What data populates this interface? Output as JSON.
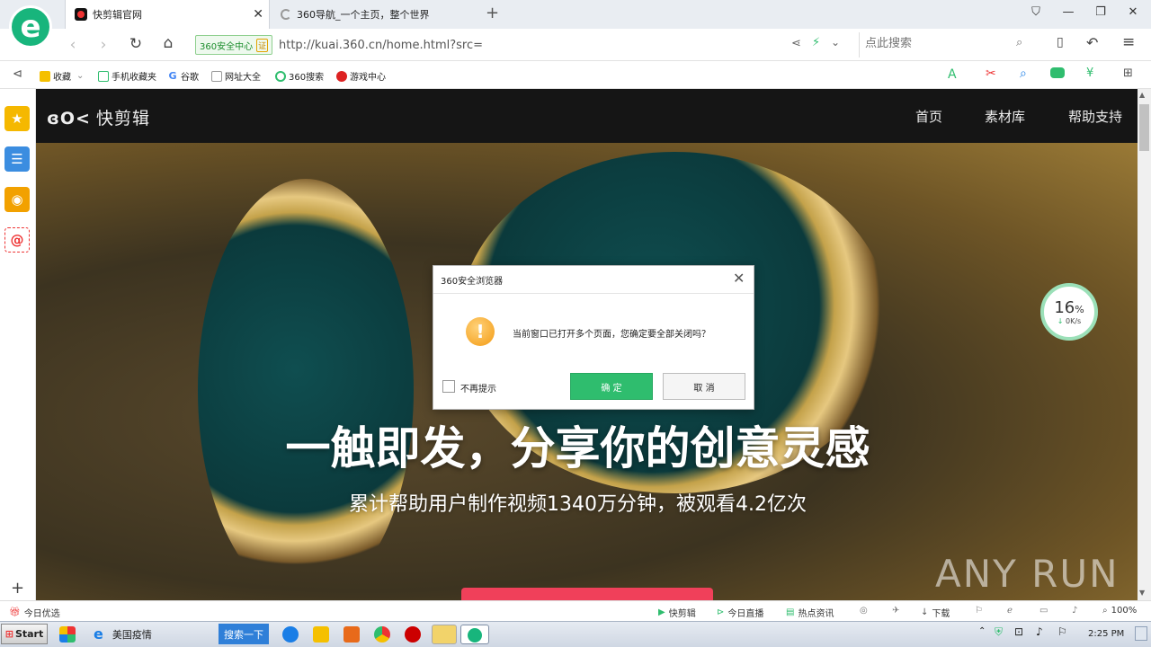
{
  "browser": {
    "tabs": [
      {
        "title": "快剪辑官网",
        "active": true
      },
      {
        "title": "360导航_一个主页，整个世界",
        "active": false
      }
    ],
    "address": {
      "security_badge": "360安全中心",
      "security_badge_cert": "证",
      "url": "http://kuai.360.cn/home.html?src=",
      "search_placeholder": "点此搜索"
    },
    "bookmarks": [
      "收藏",
      "手机收藏夹",
      "谷歌",
      "网址大全",
      "360搜索",
      "游戏中心"
    ]
  },
  "site": {
    "logo": "快剪辑",
    "nav": [
      "首页",
      "素材库",
      "帮助支持"
    ],
    "hero_title": "一触即发，分享你的创意灵感",
    "hero_subtitle": "累计帮助用户制作视频1340万分钟，被观看4.2亿次",
    "speed_widget": {
      "percent": "16",
      "percent_unit": "%",
      "rate": "0K/s"
    }
  },
  "dialog": {
    "title": "360安全浏览器",
    "message": "当前窗口已打开多个页面，您确定要全部关闭吗？",
    "checkbox_label": "不再提示",
    "ok_label": "确 定",
    "cancel_label": "取 消"
  },
  "statusbar": {
    "left": "今日优选",
    "items": [
      "快剪辑",
      "今日直播",
      "热点资讯",
      "下载"
    ],
    "zoom": "100%"
  },
  "taskbar": {
    "start": "Start",
    "items": [
      "美国疫情",
      "搜索一下"
    ],
    "clock": "2:25 PM"
  },
  "watermark": "ANY RUN"
}
